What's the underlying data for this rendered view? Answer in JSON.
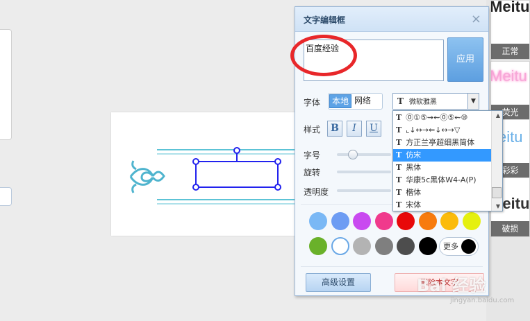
{
  "dialog": {
    "title": "文字编辑框",
    "close_icon": "×",
    "text_value": "百度经验",
    "apply_label": "应用",
    "font_label": "字体",
    "font_source_local": "本地",
    "font_source_web": "网络",
    "selected_font": "微软雅黑",
    "style_label": "样式",
    "bold": "B",
    "italic": "I",
    "underline": "U",
    "size_label": "字号",
    "rotate_label": "旋转",
    "opacity_label": "透明度",
    "more_label": "更多",
    "advanced_label": "高级设置",
    "delete_label": "删除本文字"
  },
  "font_list": [
    {
      "name": "⓪①⑤⇝⇜⓪⑤⇜⑩"
    },
    {
      "name": "⌞↓↔→⇐↓↔→▽"
    },
    {
      "name": "方正兰亭超细黑简体"
    },
    {
      "name": "仿宋"
    },
    {
      "name": "黑体"
    },
    {
      "name": "华康5c黑体W4-A(P)"
    },
    {
      "name": "楷体"
    },
    {
      "name": "宋体"
    }
  ],
  "colors": {
    "row1": [
      "#7ab8f5",
      "#6d9cf3",
      "#c94af0",
      "#f03a8c",
      "#e8080a",
      "#f77b0e",
      "#fbbb0b",
      "#e5f010"
    ],
    "row2": [
      "#6ab12a",
      "#ffffff",
      "#b3b3b3",
      "#7f7f7f",
      "#4d4d4d",
      "#000000"
    ]
  },
  "presets": [
    {
      "sample": "Meitu",
      "label": "正常"
    },
    {
      "sample": "Meitu",
      "label": "荧光"
    },
    {
      "sample": "eitu",
      "label": "彩彩"
    },
    {
      "sample": "Meitu",
      "label": "破损"
    }
  ],
  "watermark": {
    "text": "Bai 经验",
    "url": "jingyan.baidu.com"
  }
}
